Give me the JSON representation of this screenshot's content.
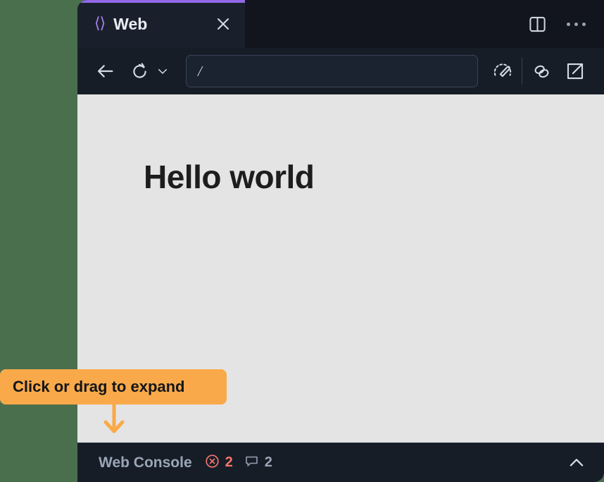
{
  "window": {
    "background_color": "#4a6f4d",
    "chrome_color": "#171d27"
  },
  "tab_strip": {
    "tabs": [
      {
        "icon": "code-brackets-icon",
        "label": "Web",
        "close_label": "✕",
        "active": true,
        "accent_color": "#9268e8"
      }
    ],
    "actions": [
      {
        "name": "split-view-icon",
        "label": "Split view"
      },
      {
        "name": "more-options-icon",
        "label": "More options"
      }
    ]
  },
  "toolbar": {
    "back_label": "Back",
    "reload_label": "Reload",
    "reload_dropdown_label": "Reload options",
    "url": {
      "value": "/",
      "placeholder": "/"
    },
    "right_actions": [
      {
        "name": "performance-icon",
        "label": "Performance"
      },
      {
        "name": "link-icon",
        "label": "Copy link"
      },
      {
        "name": "open-external-icon",
        "label": "Open in browser"
      }
    ]
  },
  "page": {
    "background_color": "#e4e4e4",
    "heading": "Hello world"
  },
  "console_bar": {
    "title": "Web Console",
    "error_icon": "circle-x-icon",
    "error_count": "2",
    "error_color": "#f4756c",
    "message_icon": "speech-bubble-icon",
    "message_count": "2",
    "message_color": "#9aa6b6",
    "expand_icon": "chevron-up-icon"
  },
  "tooltip": {
    "text": "Click or drag to expand",
    "background_color": "#f9a949",
    "text_color": "#14161a",
    "arrow_icon": "arrow-down-icon"
  }
}
